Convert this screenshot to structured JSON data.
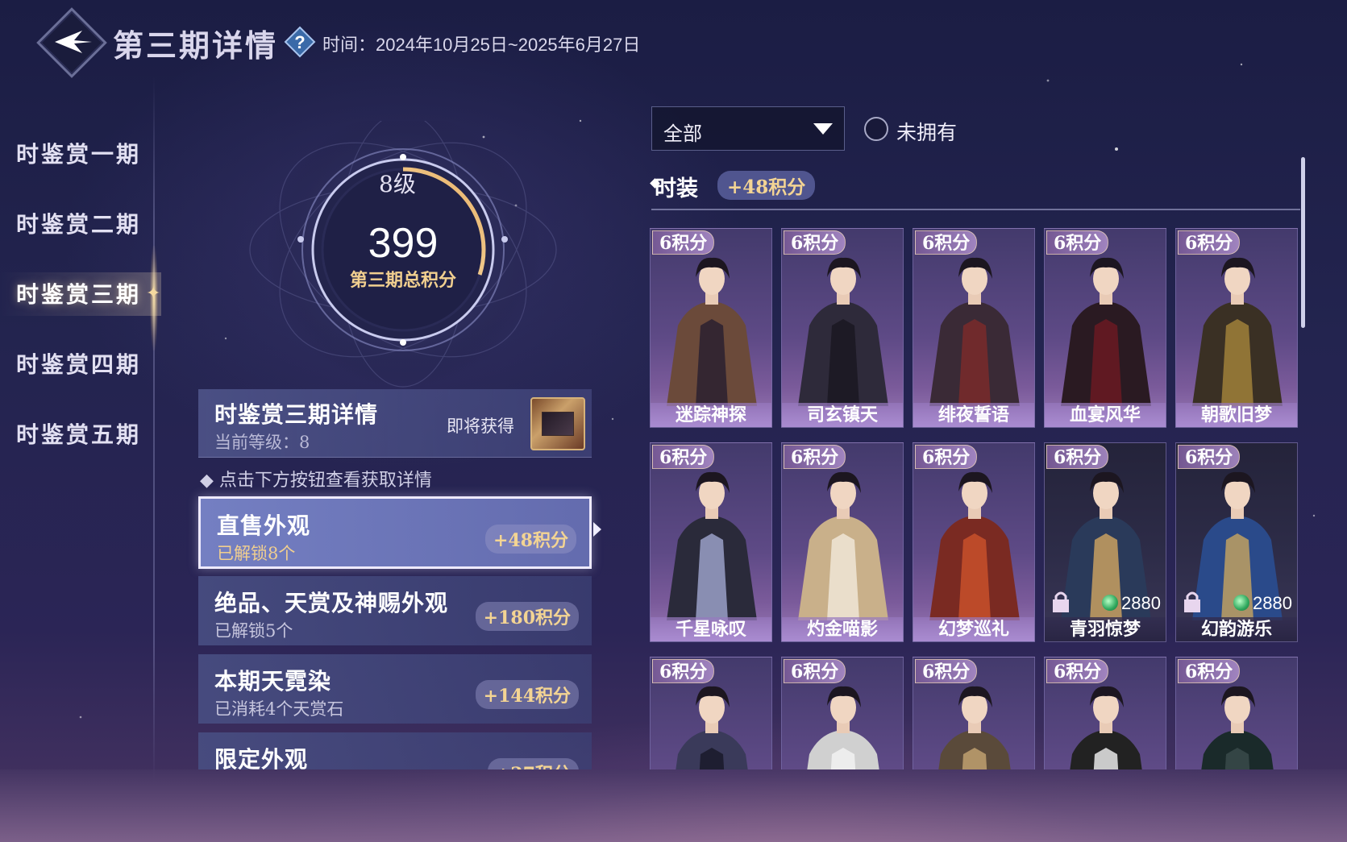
{
  "header": {
    "title": "第三期详情",
    "help_icon": "question-icon",
    "time_label": "时间：2024年10月25日~2025年6月27日"
  },
  "sidebar": {
    "items": [
      {
        "label": "时鉴赏一期"
      },
      {
        "label": "时鉴赏二期"
      },
      {
        "label": "时鉴赏三期"
      },
      {
        "label": "时鉴赏四期"
      },
      {
        "label": "时鉴赏五期"
      }
    ],
    "active_index": 2
  },
  "score": {
    "level": "8级",
    "total": "399",
    "label": "第三期总积分",
    "ring_progress": 0.3
  },
  "detail_card": {
    "title": "时鉴赏三期详情",
    "level_text": "当前等级：8",
    "soon_label": "即将获得"
  },
  "hint": "点击下方按钮查看获取详情",
  "actions": [
    {
      "title": "直售外观",
      "sub": "已解锁8个",
      "points": "+48积分"
    },
    {
      "title": "绝品、天赏及神赐外观",
      "sub": "已解锁5个",
      "points": "+180积分"
    },
    {
      "title": "本期天霓染",
      "sub": "已消耗4个天赏石",
      "points": "+144积分"
    },
    {
      "title": "限定外观",
      "sub": "",
      "points": "+27积分"
    }
  ],
  "filter": {
    "selected": "全部",
    "owned_toggle_label": "未拥有"
  },
  "section": {
    "title": "时装",
    "points": "+48积分"
  },
  "cards": [
    {
      "badge": "6积分",
      "name": "迷踪神探",
      "price": ""
    },
    {
      "badge": "6积分",
      "name": "司玄镇天",
      "price": ""
    },
    {
      "badge": "6积分",
      "name": "绯夜誓语",
      "price": ""
    },
    {
      "badge": "6积分",
      "name": "血宴风华",
      "price": ""
    },
    {
      "badge": "6积分",
      "name": "朝歌旧梦",
      "price": ""
    },
    {
      "badge": "6积分",
      "name": "千星咏叹",
      "price": ""
    },
    {
      "badge": "6积分",
      "name": "灼金喵影",
      "price": ""
    },
    {
      "badge": "6积分",
      "name": "幻梦巡礼",
      "price": ""
    },
    {
      "badge": "6积分",
      "name": "青羽惊梦",
      "price": "2880"
    },
    {
      "badge": "6积分",
      "name": "幻韵游乐",
      "price": "2880"
    },
    {
      "badge": "6积分",
      "name": "",
      "price": ""
    },
    {
      "badge": "6积分",
      "name": "",
      "price": ""
    },
    {
      "badge": "6积分",
      "name": "",
      "price": ""
    },
    {
      "badge": "6积分",
      "name": "",
      "price": ""
    },
    {
      "badge": "6积分",
      "name": "",
      "price": ""
    }
  ],
  "colors": {
    "gold": "#f3d493",
    "panel": "#484e82",
    "card_purple": "#5e4a86"
  }
}
